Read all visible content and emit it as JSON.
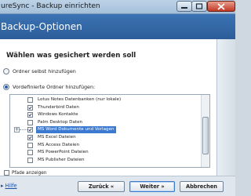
{
  "window": {
    "title": "ureSync - Backup einrichten"
  },
  "header": {
    "title": "Backup-Optionen"
  },
  "section": {
    "title": "Wählen was gesichert werden soll"
  },
  "options": {
    "custom_folders": {
      "label": "Ordner selbst hinzufügen",
      "selected": false
    },
    "predefined_folders": {
      "label": "Vordefinierte Ordner hinzufügen:",
      "selected": true
    }
  },
  "folders": {
    "items": [
      {
        "label": "Lotus Notes Datenbanken (nur lokale)",
        "checked": false,
        "selected": false,
        "expander": false
      },
      {
        "label": "Thunderbird Daten",
        "checked": true,
        "selected": false,
        "expander": false
      },
      {
        "label": "Windows Kontakte",
        "checked": true,
        "selected": false,
        "expander": false
      },
      {
        "label": "Palm Desktop Daten",
        "checked": false,
        "selected": false,
        "expander": false
      },
      {
        "label": "MS Word Dokumente und Vorlagen",
        "checked": true,
        "selected": true,
        "expander": true
      },
      {
        "label": "MS Excel Dateien",
        "checked": true,
        "selected": false,
        "expander": false
      },
      {
        "label": "MS Access Dateien",
        "checked": false,
        "selected": false,
        "expander": false
      },
      {
        "label": "MS PowerPoint Dateien",
        "checked": false,
        "selected": false,
        "expander": false
      },
      {
        "label": "MS Publisher Dateien",
        "checked": false,
        "selected": false,
        "expander": false
      }
    ]
  },
  "show_paths": {
    "label": "Pfade anzeigen",
    "checked": false
  },
  "footer": {
    "help_label": "Hilfe",
    "back_label": "Zurück «",
    "next_label": "Weiter »",
    "cancel_label": "Abbrechen"
  }
}
